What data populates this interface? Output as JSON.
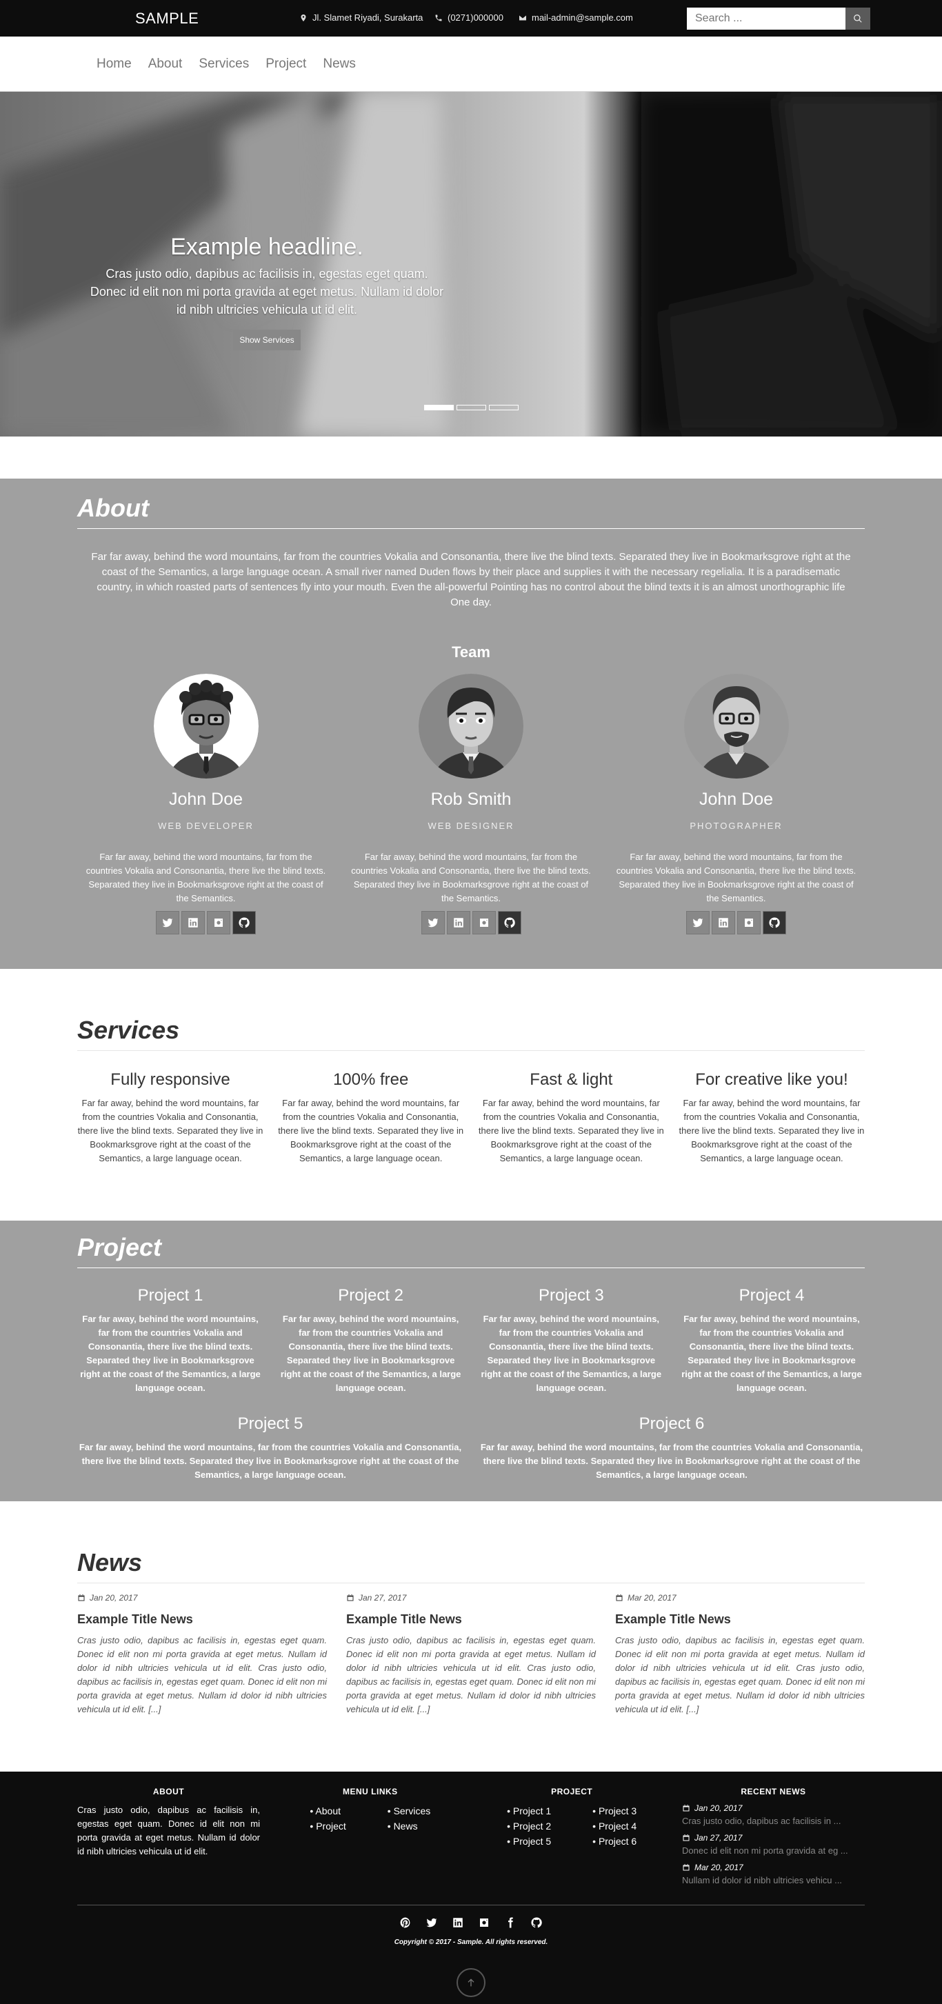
{
  "topbar": {
    "brand": "SAMPLE",
    "address": "Jl. Slamet Riyadi, Surakarta",
    "phone": "(0271)000000",
    "email": "mail-admin@sample.com",
    "search_placeholder": "Search ..."
  },
  "nav": [
    "Home",
    "About",
    "Services",
    "Project",
    "News"
  ],
  "hero": {
    "title": "Example headline.",
    "text": "Cras justo odio, dapibus ac facilisis in, egestas eget quam. Donec id elit non mi porta gravida at eget metus. Nullam id dolor id nibh ultricies vehicula ut id elit.",
    "button": "Show Services",
    "slides": 3,
    "active_slide": 1
  },
  "about": {
    "title": "About",
    "text": "Far far away, behind the word mountains, far from the countries Vokalia and Consonantia, there live the blind texts. Separated they live in Bookmarksgrove right at the coast of the Semantics, a large language ocean. A small river named Duden flows by their place and supplies it with the necessary regelialia. It is a paradisematic country, in which roasted parts of sentences fly into your mouth. Even the all-powerful Pointing has no control about the blind texts it is an almost unorthographic life One day.",
    "team_title": "Team",
    "members": [
      {
        "name": "John Doe",
        "role": "WEB DEVELOPER",
        "text": "Far far away, behind the word mountains, far from the countries Vokalia and Consonantia, there live the blind texts. Separated they live in Bookmarksgrove right at the coast of the Semantics."
      },
      {
        "name": "Rob Smith",
        "role": "WEB DESIGNER",
        "text": "Far far away, behind the word mountains, far from the countries Vokalia and Consonantia, there live the blind texts. Separated they live in Bookmarksgrove right at the coast of the Semantics."
      },
      {
        "name": "John Doe",
        "role": "PHOTOGRAPHER",
        "text": "Far far away, behind the word mountains, far from the countries Vokalia and Consonantia, there live the blind texts. Separated they live in Bookmarksgrove right at the coast of the Semantics."
      }
    ]
  },
  "services": {
    "title": "Services",
    "items": [
      {
        "title": "Fully responsive",
        "text": "Far far away, behind the word mountains, far from the countries Vokalia and Consonantia, there live the blind texts. Separated they live in Bookmarksgrove right at the coast of the Semantics, a large language ocean."
      },
      {
        "title": "100% free",
        "text": "Far far away, behind the word mountains, far from the countries Vokalia and Consonantia, there live the blind texts. Separated they live in Bookmarksgrove right at the coast of the Semantics, a large language ocean."
      },
      {
        "title": "Fast & light",
        "text": "Far far away, behind the word mountains, far from the countries Vokalia and Consonantia, there live the blind texts. Separated they live in Bookmarksgrove right at the coast of the Semantics, a large language ocean."
      },
      {
        "title": "For creative like you!",
        "text": "Far far away, behind the word mountains, far from the countries Vokalia and Consonantia, there live the blind texts. Separated they live in Bookmarksgrove right at the coast of the Semantics, a large language ocean."
      }
    ]
  },
  "project": {
    "title": "Project",
    "items": [
      {
        "title": "Project 1",
        "text": "Far far away, behind the word mountains, far from the countries Vokalia and Consonantia, there live the blind texts. Separated they live in Bookmarksgrove right at the coast of the Semantics, a large language ocean."
      },
      {
        "title": "Project 2",
        "text": "Far far away, behind the word mountains, far from the countries Vokalia and Consonantia, there live the blind texts. Separated they live in Bookmarksgrove right at the coast of the Semantics, a large language ocean."
      },
      {
        "title": "Project 3",
        "text": "Far far away, behind the word mountains, far from the countries Vokalia and Consonantia, there live the blind texts. Separated they live in Bookmarksgrove right at the coast of the Semantics, a large language ocean."
      },
      {
        "title": "Project 4",
        "text": "Far far away, behind the word mountains, far from the countries Vokalia and Consonantia, there live the blind texts. Separated they live in Bookmarksgrove right at the coast of the Semantics, a large language ocean."
      },
      {
        "title": "Project 5",
        "text": "Far far away, behind the word mountains, far from the countries Vokalia and Consonantia, there live the blind texts. Separated they live in Bookmarksgrove right at the coast of the Semantics, a large language ocean."
      },
      {
        "title": "Project 6",
        "text": "Far far away, behind the word mountains, far from the countries Vokalia and Consonantia, there live the blind texts. Separated they live in Bookmarksgrove right at the coast of the Semantics, a large language ocean."
      }
    ]
  },
  "news": {
    "title": "News",
    "items": [
      {
        "date": "Jan 20, 2017",
        "title": "Example Title News",
        "text": "Cras justo odio, dapibus ac facilisis in, egestas eget quam. Donec id elit non mi porta gravida at eget metus. Nullam id dolor id nibh ultricies vehicula ut id elit. Cras justo odio, dapibus ac facilisis in, egestas eget quam. Donec id elit non mi porta gravida at eget metus. Nullam id dolor id nibh ultricies vehicula ut id elit. [...]"
      },
      {
        "date": "Jan 27, 2017",
        "title": "Example Title News",
        "text": "Cras justo odio, dapibus ac facilisis in, egestas eget quam. Donec id elit non mi porta gravida at eget metus. Nullam id dolor id nibh ultricies vehicula ut id elit. Cras justo odio, dapibus ac facilisis in, egestas eget quam. Donec id elit non mi porta gravida at eget metus. Nullam id dolor id nibh ultricies vehicula ut id elit. [...]"
      },
      {
        "date": "Mar 20, 2017",
        "title": "Example Title News",
        "text": "Cras justo odio, dapibus ac facilisis in, egestas eget quam. Donec id elit non mi porta gravida at eget metus. Nullam id dolor id nibh ultricies vehicula ut id elit. Cras justo odio, dapibus ac facilisis in, egestas eget quam. Donec id elit non mi porta gravida at eget metus. Nullam id dolor id nibh ultricies vehicula ut id elit. [...]"
      }
    ]
  },
  "footer": {
    "about_title": "ABOUT",
    "about_text": "Cras justo odio, dapibus ac facilisis in, egestas eget quam. Donec id elit non mi porta gravida at eget metus. Nullam id dolor id nibh ultricies vehicula ut id elit.",
    "menu_title": "MENU LINKS",
    "menu_col1": [
      "About",
      "Project"
    ],
    "menu_col2": [
      "Services",
      "News"
    ],
    "project_title": "PROJECT",
    "project_col1": [
      "Project 1",
      "Project 2",
      "Project 5"
    ],
    "project_col2": [
      "Project 3",
      "Project 4",
      "Project 6"
    ],
    "recent_title": "RECENT NEWS",
    "recent": [
      {
        "date": "Jan 20, 2017",
        "text": "Cras justo odio, dapibus ac facilisis in ..."
      },
      {
        "date": "Jan 27, 2017",
        "text": "Donec id elit non mi porta gravida at eg ..."
      },
      {
        "date": "Mar 20, 2017",
        "text": "Nullam id dolor id nibh ultricies vehicu ..."
      }
    ],
    "copyright": "Copyright © 2017 - Sample. All rights reserved."
  },
  "colors": {
    "topbar": "#0d0d0d",
    "section_gray": "#a0a0a0",
    "footer": "#0d0d0d"
  }
}
